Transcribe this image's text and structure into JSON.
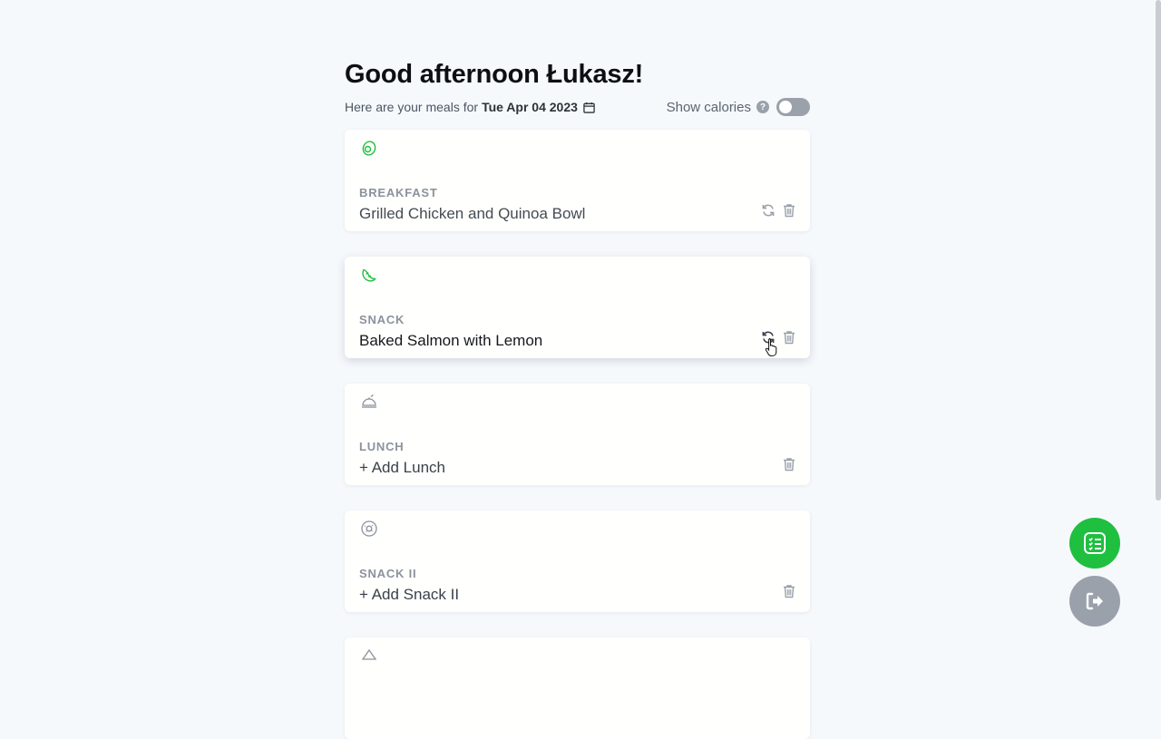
{
  "header": {
    "greeting": "Good afternoon Łukasz!",
    "subtitle_prefix": "Here are your meals for",
    "date": "Tue Apr 04 2023",
    "show_calories_label": "Show calories",
    "help_glyph": "?"
  },
  "meals": [
    {
      "label": "BREAKFAST",
      "name": "Grilled Chicken and Quinoa Bowl",
      "icon": "egg-icon",
      "has_refresh": true
    },
    {
      "label": "SNACK",
      "name": "Baked Salmon with Lemon",
      "icon": "croissant-icon",
      "has_refresh": true
    },
    {
      "label": "LUNCH",
      "name": "+ Add Lunch",
      "icon": "cloche-icon",
      "has_refresh": false
    },
    {
      "label": "SNACK II",
      "name": "+ Add Snack II",
      "icon": "donut-icon",
      "has_refresh": false
    }
  ],
  "colors": {
    "accent_green": "#1fbf40",
    "muted_gray": "#9aa1ab"
  }
}
